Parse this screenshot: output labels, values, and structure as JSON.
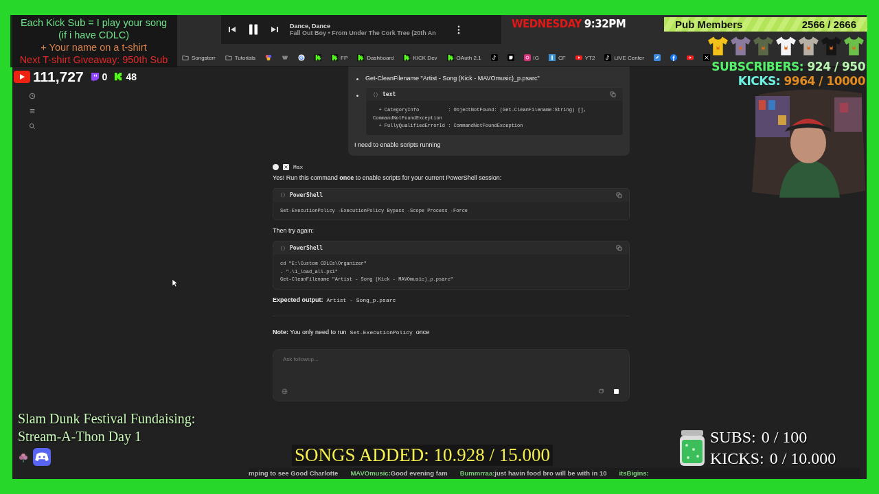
{
  "browser": {
    "bookmarks": [
      {
        "kind": "folder",
        "label": "Songsterr"
      },
      {
        "kind": "folder",
        "label": "Tutorials"
      },
      {
        "kind": "multicolor"
      },
      {
        "kind": "tray"
      },
      {
        "kind": "google"
      },
      {
        "kind": "kick"
      },
      {
        "kind": "kick",
        "label": "FP"
      },
      {
        "kind": "kick",
        "label": "Dashboard"
      },
      {
        "kind": "kick",
        "label": "KICK Dev"
      },
      {
        "kind": "kick",
        "label": "OAuth 2.1"
      },
      {
        "kind": "tiktok"
      },
      {
        "kind": "paper"
      },
      {
        "kind": "instagram",
        "label": "IG"
      },
      {
        "kind": "bar",
        "label": "CF"
      },
      {
        "kind": "youtube",
        "label": "YT2"
      },
      {
        "kind": "tiktok",
        "label": "LIVE Center"
      },
      {
        "kind": "bluebird"
      },
      {
        "kind": "facebook"
      },
      {
        "kind": "youtube"
      },
      {
        "kind": "x"
      }
    ],
    "messages": [
      {
        "kind": "user",
        "blocks": [
          {
            "kind": "bullet",
            "text": "Get-CleanFilename \"Artist - Song (Kick - MAVOmusic)_p.psarc\""
          },
          {
            "kind": "bullet-code",
            "lang": "text",
            "lines": [
              "  + CategoryInfo          : ObjectNotFound: (Get-CleanFilename:String) [],",
              "CommandNotFoundException",
              "  + FullyQualifiedErrorId : CommandNotFoundException"
            ]
          },
          {
            "kind": "para",
            "segments": [
              {
                "kind": "text",
                "text": "I need to enable scripts running"
              }
            ]
          }
        ]
      },
      {
        "kind": "assistant",
        "model": "Max",
        "blocks": [
          {
            "kind": "para",
            "segments": [
              {
                "kind": "text",
                "text": "Yes! Run this command **once** to enable scripts for your current PowerShell session:"
              }
            ]
          },
          {
            "kind": "code",
            "lang": "PowerShell",
            "lines": [
              "Set-ExecutionPolicy -ExecutionPolicy Bypass -Scope Process -Force"
            ]
          },
          {
            "kind": "para",
            "segments": [
              {
                "kind": "text",
                "text": "Then try again:"
              }
            ]
          },
          {
            "kind": "code",
            "lang": "PowerShell",
            "lines": [
              "cd \"E:\\Custom CDLCs\\Organizer\"",
              ". \".\\1_load_all.ps1\"",
              "Get-CleanFilename \"Artist - Song (Kick - MAVOmusic)_p.psarc\""
            ]
          },
          {
            "kind": "para",
            "segments": [
              {
                "kind": "text",
                "text": "**Expected output:**"
              },
              {
                "kind": "code",
                "text": "Artist - Song_p.psarc"
              }
            ]
          },
          {
            "kind": "rule"
          },
          {
            "kind": "para",
            "segments": [
              {
                "kind": "text",
                "text": "**Note:** You only need to run"
              },
              {
                "kind": "code",
                "text": "Set-ExecutionPolicy"
              },
              {
                "kind": "text",
                "text": "once"
              }
            ]
          }
        ]
      }
    ],
    "input": {
      "placeholder": "Ask followup..."
    }
  },
  "overlay": {
    "promo_lines": [
      {
        "text": "Each Kick Sub = I play your song",
        "color": "#6fe08a"
      },
      {
        "text": "(if i have CDLC)",
        "color": "#6fe08a"
      },
      {
        "text": "+ Your name on a t-shirt",
        "color": "#d9824a"
      },
      {
        "text": "Next T-shirt Giveaway: 950th Sub",
        "color": "#e02a2a"
      }
    ],
    "counters": [
      {
        "kind": "youtube",
        "value": "111,727"
      },
      {
        "kind": "twitch",
        "value": "0"
      },
      {
        "kind": "kick",
        "value": "48"
      }
    ],
    "player": {
      "title": "Dance, Dance",
      "subtitle": "Fall Out Boy • From Under The Cork Tree (20th An",
      "playing": true
    },
    "clock": {
      "day": "WEDNESDAY",
      "time": "9:32PM"
    },
    "pub_members": {
      "label": "Pub Members",
      "count": "2566 / 2666"
    },
    "tshirts": [
      {
        "color": "#f2c21a"
      },
      {
        "color": "#8a7a9e"
      },
      {
        "color": "#5a6848"
      },
      {
        "color": "#f4f4f4"
      },
      {
        "color": "#b8b0a4"
      },
      {
        "color": "#151515"
      },
      {
        "color": "#6cc04a"
      }
    ],
    "goals": [
      {
        "label": "SUBSCRIBERS:",
        "value": "924 / 950"
      },
      {
        "label": "KICKS:",
        "value": "9964 / 10000"
      }
    ],
    "festival": [
      "Slam Dunk Festival Fundaising:",
      "Stream-A-Thon Day 1"
    ],
    "songs_added": "SONGS ADDED: 10.928 / 15.000",
    "bottom_goals": [
      {
        "label": "SUBS:",
        "value": "0 / 100"
      },
      {
        "label": "KICKS:",
        "value": "0 / 10.000"
      }
    ],
    "ticker": [
      {
        "text": "mping to see Good Charlotte"
      },
      {
        "user": "MAVOmusic:",
        "text": "Good evening fam"
      },
      {
        "user": "Bummrraa:",
        "text": "just havin food bro will be with in 10"
      },
      {
        "user": "itsBigins:"
      }
    ]
  }
}
